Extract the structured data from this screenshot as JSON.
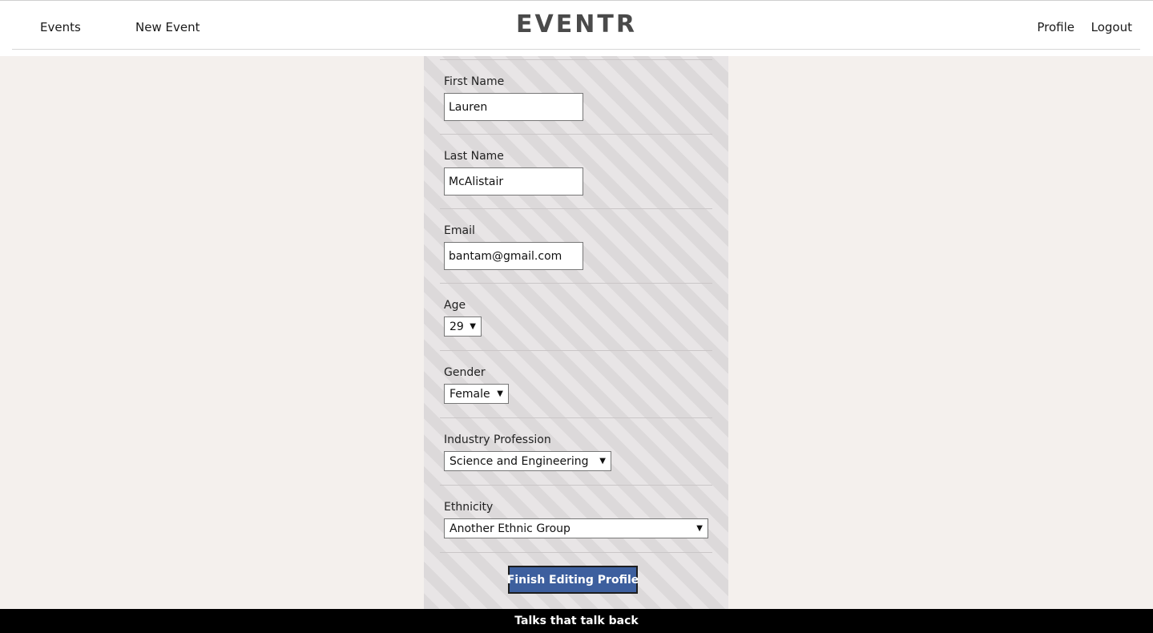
{
  "header": {
    "logo": "EVENTR",
    "nav_left": {
      "events": "Events",
      "new_event": "New Event"
    },
    "nav_right": {
      "profile": "Profile",
      "logout": "Logout"
    }
  },
  "form": {
    "first_name": {
      "label": "First Name",
      "value": "Lauren"
    },
    "last_name": {
      "label": "Last Name",
      "value": "McAlistair"
    },
    "email": {
      "label": "Email",
      "value": "bantam@gmail.com"
    },
    "age": {
      "label": "Age",
      "value": "29"
    },
    "gender": {
      "label": "Gender",
      "value": "Female"
    },
    "industry": {
      "label": "Industry Profession",
      "value": "Science and Engineering"
    },
    "ethnicity": {
      "label": "Ethnicity",
      "value": "Another Ethnic Group"
    },
    "submit_label": "Finish Editing Profile"
  },
  "footer": {
    "tagline": "Talks that talk back"
  },
  "colors": {
    "page_background": "#f4f0ed",
    "button_background": "#3d5f9e",
    "footer_background": "#000000"
  }
}
